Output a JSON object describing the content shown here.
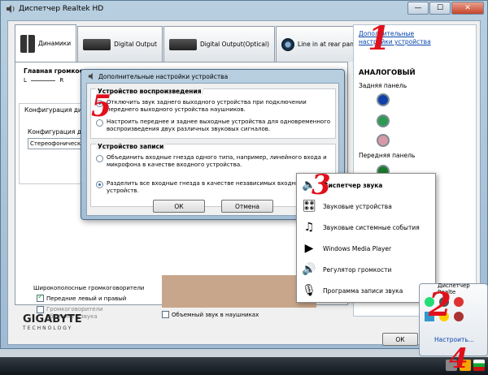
{
  "window": {
    "title": "Диспетчер Realtek HD",
    "buttons": [
      "—",
      "☐",
      "✕"
    ]
  },
  "tabs": [
    {
      "label": "Динамики"
    },
    {
      "label": "Digital Output"
    },
    {
      "label": "Digital Output(Optical)"
    },
    {
      "label": "Line in at rear panel (Blue)"
    }
  ],
  "main": {
    "master_volume_label": "Главная громкость",
    "lr_label": "L",
    "lr_label_r": "R",
    "config_tab_label": "Конфигурация динами",
    "config_sub_label": "Конфигурация динами",
    "config_select_value": "Стереофонический",
    "wide_label": "Широкополосные громкоговорители",
    "front_lr_label": "Передние левый и правый",
    "surround_label": "Громкоговорители объемного звука",
    "headphone_label": "Объемный звук в наушниках",
    "ok_label": "ОК"
  },
  "right_panel": {
    "link": "Дополнительные настройки устройства",
    "analog": "АНАЛОГОВЫЙ",
    "rear": "Задняя панель",
    "front": "Передняя панель",
    "jack_colors": [
      "#1040a8",
      "#2e9a52",
      "#d89aa8",
      "#1a7a2a"
    ]
  },
  "brand": {
    "name": "GIGABYTE",
    "sub": "TECHNOLOGY"
  },
  "dialog": {
    "title": "Дополнительные настройки устройства",
    "playback_title": "Устройство воспроизведения",
    "playback_opt1": "Отключить звук заднего выходного устройства при подключении переднего выходного устройства наушников.",
    "playback_opt2": "Настроить переднее и заднее выходные устройства для одновременного воспроизведения двух различных звуковых сигналов.",
    "record_title": "Устройство записи",
    "record_opt1": "Объединить входные гнезда одного типа, например, линейного входа и микрофона в качестве входного устройства.",
    "record_opt2": "Разделить все входные гнезда в качестве независимых входных устройств.",
    "ok": "ОК",
    "cancel": "Отмена"
  },
  "menu": {
    "items": [
      {
        "label": "Диспетчер звука",
        "icon": "speaker-icon"
      },
      {
        "label": "Звуковые устройства",
        "icon": "sound-devices-icon"
      },
      {
        "label": "Звуковые системные события",
        "icon": "system-sounds-icon"
      },
      {
        "label": "Windows Media Player",
        "icon": "media-player-icon"
      },
      {
        "label": "Регулятор громкости",
        "icon": "volume-icon"
      },
      {
        "label": "Программа записи звука",
        "icon": "recorder-icon"
      }
    ]
  },
  "tray": {
    "label": "Диспетчер Realte",
    "link": "Настроить..."
  },
  "annotations": [
    "1",
    "2",
    "3",
    "4",
    "5"
  ]
}
